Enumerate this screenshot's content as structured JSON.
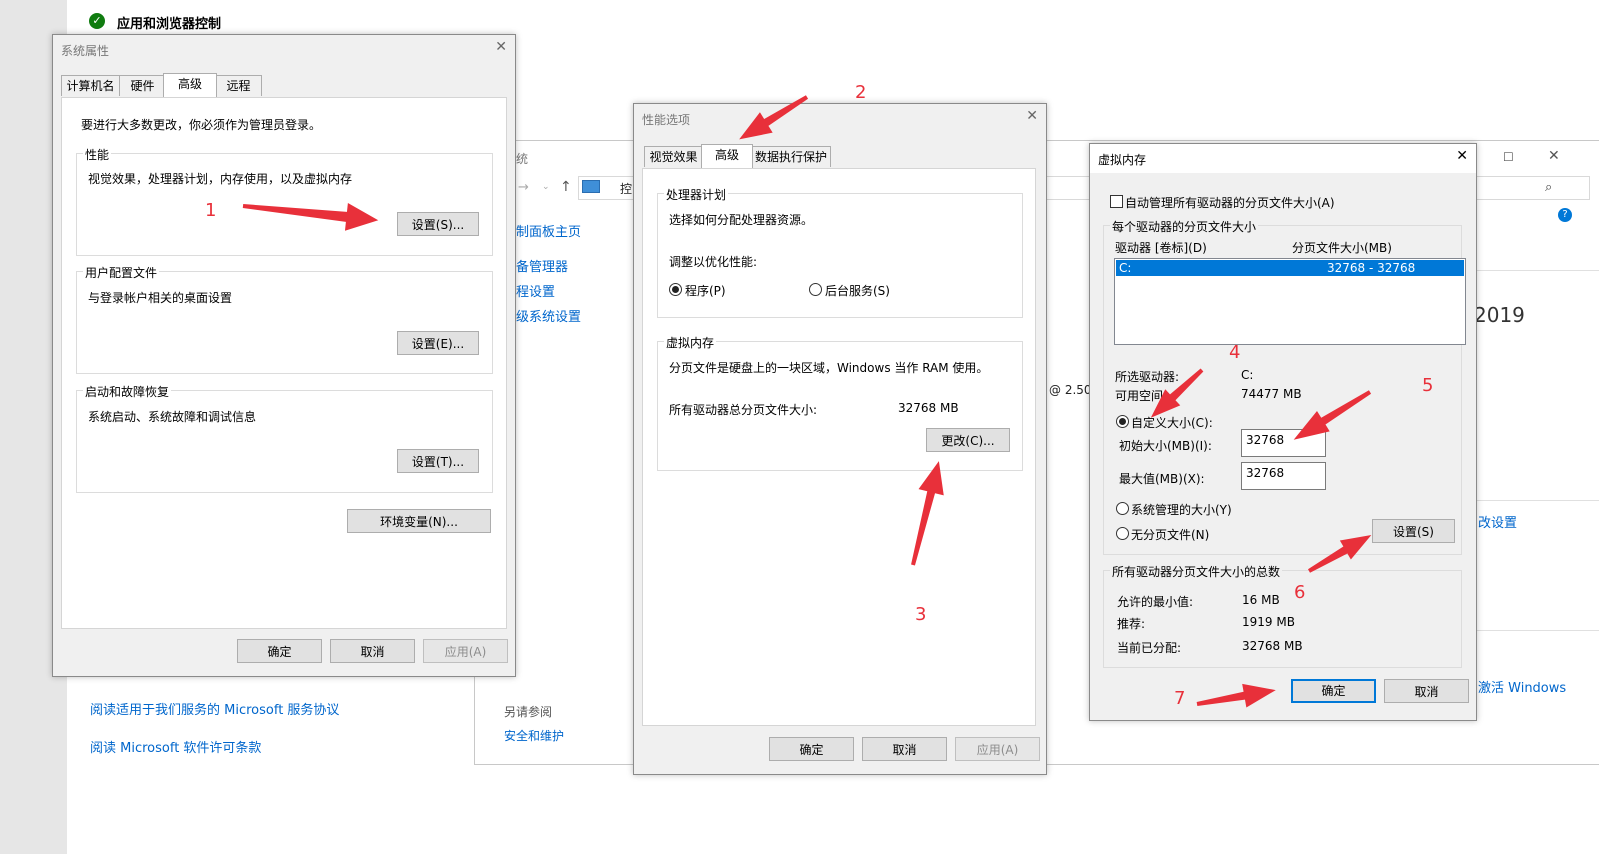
{
  "background": {
    "top_title": "应用和浏览器控制",
    "cp_title": "统",
    "cp_path": "控",
    "cp_links": [
      "制面板主页",
      "备管理器",
      "程设置",
      "级系统设置"
    ],
    "partial_year": "2019",
    "partial_cpu": "@ 2.50",
    "partial_change": "改设置",
    "partial_activate": "激活 Windows",
    "see_also": "另请参阅",
    "security": "安全和维护",
    "ms_link1": "阅读适用于我们服务的 Microsoft 服务协议",
    "ms_link2": "阅读 Microsoft 软件许可条款"
  },
  "sysprop": {
    "title": "系统属性",
    "tabs": [
      "计算机名",
      "硬件",
      "高级",
      "远程"
    ],
    "admin_note": "要进行大多数更改，你必须作为管理员登录。",
    "perf_label": "性能",
    "perf_desc": "视觉效果，处理器计划，内存使用，以及虚拟内存",
    "perf_btn": "设置(S)...",
    "profile_label": "用户配置文件",
    "profile_desc": "与登录帐户相关的桌面设置",
    "profile_btn": "设置(E)...",
    "startup_label": "启动和故障恢复",
    "startup_desc": "系统启动、系统故障和调试信息",
    "startup_btn": "设置(T)...",
    "env_btn": "环境变量(N)...",
    "ok": "确定",
    "cancel": "取消",
    "apply": "应用(A)"
  },
  "perfopt": {
    "title": "性能选项",
    "tabs": [
      "视觉效果",
      "高级",
      "数据执行保护"
    ],
    "sched_label": "处理器计划",
    "sched_desc": "选择如何分配处理器资源。",
    "sched_adjust": "调整以优化性能:",
    "radio_programs": "程序(P)",
    "radio_background": "后台服务(S)",
    "vm_label": "虚拟内存",
    "vm_desc": "分页文件是硬盘上的一块区域，Windows 当作 RAM 使用。",
    "vm_total_label": "所有驱动器总分页文件大小:",
    "vm_total_value": "32768 MB",
    "change_btn": "更改(C)...",
    "ok": "确定",
    "cancel": "取消",
    "apply": "应用(A)"
  },
  "vmem": {
    "title": "虚拟内存",
    "auto_manage": "自动管理所有驱动器的分页文件大小(A)",
    "per_drive_label": "每个驱动器的分页文件大小",
    "col_drive": "驱动器 [卷标](D)",
    "col_size": "分页文件大小(MB)",
    "row_drive": "C:",
    "row_size": "32768 - 32768",
    "selected_drive_label": "所选驱动器:",
    "selected_drive_value": "C:",
    "available_label": "可用空间:",
    "available_value": "74477 MB",
    "custom_size": "自定义大小(C):",
    "initial_label": "初始大小(MB)(I):",
    "initial_value": "32768",
    "max_label": "最大值(MB)(X):",
    "max_value": "32768",
    "system_managed": "系统管理的大小(Y)",
    "no_paging": "无分页文件(N)",
    "set_btn": "设置(S)",
    "total_label": "所有驱动器分页文件大小的总数",
    "min_label": "允许的最小值:",
    "min_value": "16 MB",
    "recommended_label": "推荐:",
    "recommended_value": "1919 MB",
    "current_label": "当前已分配:",
    "current_value": "32768 MB",
    "ok": "确定",
    "cancel": "取消"
  },
  "annotations": [
    "1",
    "2",
    "3",
    "4",
    "5",
    "6",
    "7"
  ],
  "colors": {
    "accent": "#0078d7",
    "annotation": "#e8303a",
    "link": "#0066cc"
  }
}
